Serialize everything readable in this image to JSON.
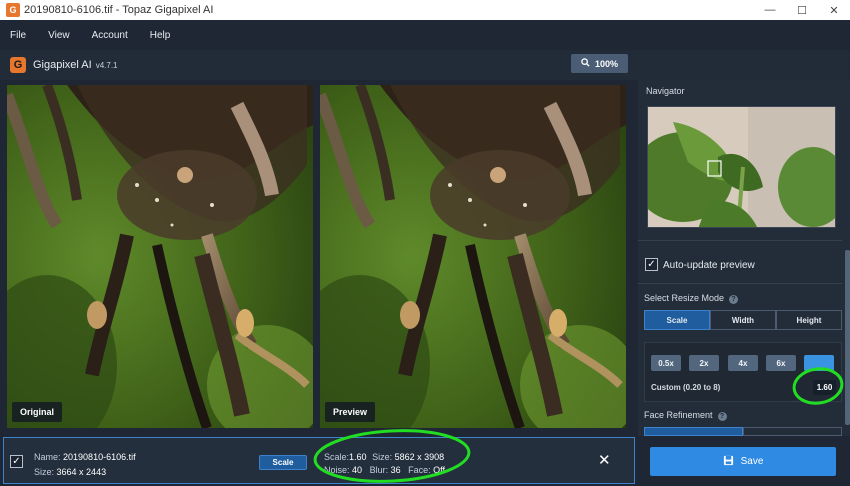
{
  "window": {
    "title": "20190810-6106.tif - Topaz Gigapixel AI",
    "controls": [
      "—",
      "☐",
      "✕"
    ]
  },
  "menu": [
    "File",
    "View",
    "Account",
    "Help"
  ],
  "header": {
    "logo_letter": "G",
    "brand": "Gigapixel AI",
    "version": "v4.7.1",
    "zoom_label": "100%"
  },
  "panes": {
    "original_label": "Original",
    "preview_label": "Preview"
  },
  "right_panel": {
    "navigator_title": "Navigator",
    "auto_update_label": "Auto-update preview",
    "auto_update_checked": true,
    "resize_mode_title": "Select Resize Mode",
    "modes": [
      "Scale",
      "Width",
      "Height"
    ],
    "active_mode": "Scale",
    "scale_buttons": [
      "0.5x",
      "2x",
      "4x",
      "6x",
      ""
    ],
    "custom_label": "Custom (0.20 to 8)",
    "custom_value": "1.60",
    "face_refinement_title": "Face Refinement"
  },
  "bottom": {
    "name_label": "Name:",
    "name_value": "20190810-6106.tif",
    "size_label": "Size:",
    "size_value": "3664 x 2443",
    "scale_button": "Scale",
    "scale_label": "Scale:",
    "scale_value": "1.60",
    "out_size_label": "Size:",
    "out_size_value": "5862 x 3908",
    "noise_label": "Noise:",
    "noise_value": "40",
    "blur_label": "Blur:",
    "blur_value": "36",
    "face_label": "Face:",
    "face_value": "Off",
    "save_label": "Save"
  },
  "colors": {
    "accent": "#2f8ae3",
    "annotation": "#22dd22",
    "logo": "#e8772e"
  }
}
